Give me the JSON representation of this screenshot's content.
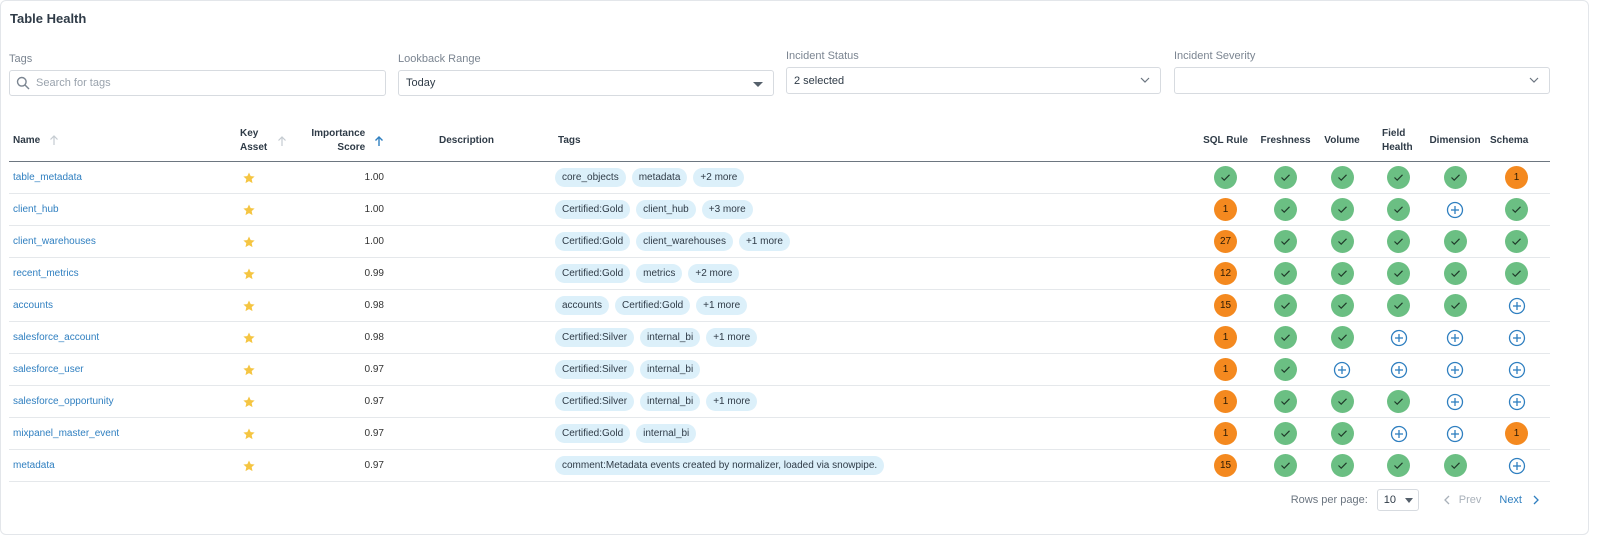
{
  "title": "Table Health",
  "filters": {
    "tags": {
      "label": "Tags",
      "placeholder": "Search for tags"
    },
    "lookback": {
      "label": "Lookback Range",
      "value": "Today"
    },
    "incident_status": {
      "label": "Incident Status",
      "value": "2 selected"
    },
    "incident_severity": {
      "label": "Incident Severity",
      "value": ""
    }
  },
  "columns": {
    "name": "Name",
    "key_asset": "Key Asset",
    "importance": "Importance Score",
    "description": "Description",
    "tags": "Tags",
    "sql_rule": "SQL Rule",
    "freshness": "Freshness",
    "volume": "Volume",
    "field_health": "Field Health",
    "dimension": "Dimension",
    "schema": "Schema"
  },
  "colors": {
    "ok": "#6bbf83",
    "warn": "#f4891f",
    "link": "#2f7fc0",
    "chip": "#dcf0fa",
    "star": "#f5c542"
  },
  "rows": [
    {
      "name": "table_metadata",
      "score": "1.00",
      "tags": [
        "core_objects",
        "metadata",
        "+2 more"
      ],
      "statuses": [
        "ok",
        "ok",
        "ok",
        "ok",
        "ok",
        "1"
      ]
    },
    {
      "name": "client_hub",
      "score": "1.00",
      "tags": [
        "Certified:Gold",
        "client_hub",
        "+3 more"
      ],
      "statuses": [
        "1",
        "ok",
        "ok",
        "ok",
        "plus",
        "ok"
      ]
    },
    {
      "name": "client_warehouses",
      "score": "1.00",
      "tags": [
        "Certified:Gold",
        "client_warehouses",
        "+1 more"
      ],
      "statuses": [
        "27",
        "ok",
        "ok",
        "ok",
        "ok",
        "ok"
      ]
    },
    {
      "name": "recent_metrics",
      "score": "0.99",
      "tags": [
        "Certified:Gold",
        "metrics",
        "+2 more"
      ],
      "statuses": [
        "12",
        "ok",
        "ok",
        "ok",
        "ok",
        "ok"
      ]
    },
    {
      "name": "accounts",
      "score": "0.98",
      "tags": [
        "accounts",
        "Certified:Gold",
        "+1 more"
      ],
      "statuses": [
        "15",
        "ok",
        "ok",
        "ok",
        "ok",
        "plus"
      ]
    },
    {
      "name": "salesforce_account",
      "score": "0.98",
      "tags": [
        "Certified:Silver",
        "internal_bi",
        "+1 more"
      ],
      "statuses": [
        "1",
        "ok",
        "ok",
        "plus",
        "plus",
        "plus"
      ]
    },
    {
      "name": "salesforce_user",
      "score": "0.97",
      "tags": [
        "Certified:Silver",
        "internal_bi"
      ],
      "statuses": [
        "1",
        "ok",
        "plus",
        "plus",
        "plus",
        "plus"
      ]
    },
    {
      "name": "salesforce_opportunity",
      "score": "0.97",
      "tags": [
        "Certified:Silver",
        "internal_bi",
        "+1 more"
      ],
      "statuses": [
        "1",
        "ok",
        "ok",
        "ok",
        "plus",
        "plus"
      ]
    },
    {
      "name": "mixpanel_master_event",
      "score": "0.97",
      "tags": [
        "Certified:Gold",
        "internal_bi"
      ],
      "statuses": [
        "1",
        "ok",
        "ok",
        "plus",
        "plus",
        "1"
      ]
    },
    {
      "name": "metadata",
      "score": "0.97",
      "tags": [
        "comment:Metadata events created by normalizer, loaded via snowpipe."
      ],
      "statuses": [
        "15",
        "ok",
        "ok",
        "ok",
        "ok",
        "plus"
      ]
    }
  ],
  "pagination": {
    "rows_per_page_label": "Rows per page:",
    "rows_per_page": "10",
    "prev": "Prev",
    "next": "Next"
  }
}
